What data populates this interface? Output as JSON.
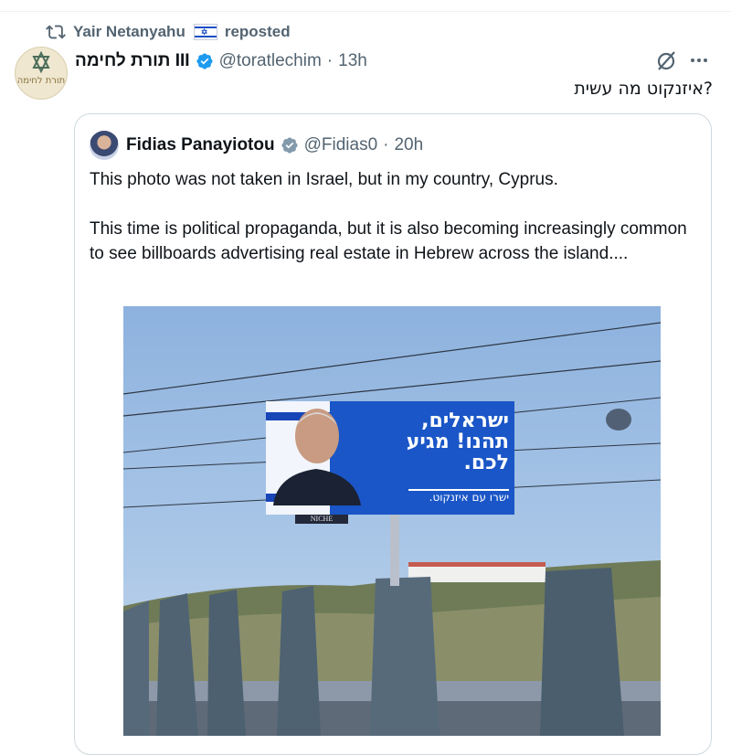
{
  "repost": {
    "user": "Yair Netanyahu",
    "suffix": "reposted"
  },
  "post": {
    "display_name": "III תורת לחימה",
    "handle": "@toratlechim",
    "separator": "·",
    "time": "13h",
    "text": "?איזנקוט מה עשית",
    "avatar_text": "תורת לחימה"
  },
  "quote": {
    "name": "Fidias Panayiotou",
    "handle": "@Fidias0",
    "separator": "·",
    "time": "20h",
    "paragraph1": "This photo was not taken in Israel, but in my country, Cyprus.",
    "paragraph2": "This time is political propaganda, but it is also becoming increasingly common to see billboards advertising real estate in Hebrew across the island...."
  },
  "billboard": {
    "headline": "ישראלים, תהנו! מגיע לכם.",
    "tagline": "ישרו עם איזנקוט.",
    "sign": "NICHE"
  },
  "colors": {
    "verified": "#1d9bf0",
    "muted": "#536471",
    "border": "#cfd9de",
    "billboard": "#1a56c7"
  },
  "icons": [
    "repost-icon",
    "israel-flag-icon",
    "verified-badge-icon",
    "grok-icon",
    "more-icon",
    "gray-verified-badge-icon"
  ]
}
